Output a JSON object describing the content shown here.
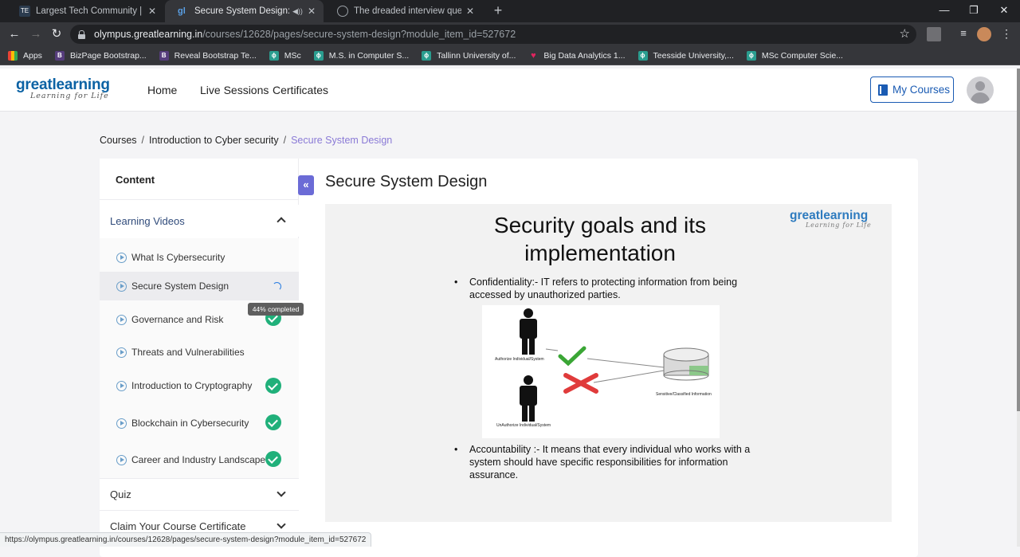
{
  "browser": {
    "tabs": [
      {
        "title": "Largest Tech Community | Hacker",
        "active": false
      },
      {
        "title": "Secure System Design: Introduc",
        "active": true
      },
      {
        "title": "The dreaded interview question:",
        "active": false
      }
    ],
    "url_host": "olympus.greatlearning.in",
    "url_path": "/courses/12628/pages/secure-system-design?module_item_id=527672",
    "bookmarks": [
      {
        "label": "Apps"
      },
      {
        "label": "BizPage Bootstrap..."
      },
      {
        "label": "Reveal Bootstrap Te..."
      },
      {
        "label": "MSc"
      },
      {
        "label": "M.S. in Computer S..."
      },
      {
        "label": "Tallinn University of..."
      },
      {
        "label": "Big Data Analytics 1..."
      },
      {
        "label": "Teesside University,..."
      },
      {
        "label": "MSc Computer Scie..."
      }
    ],
    "status_url": "https://olympus.greatlearning.in/courses/12628/pages/secure-system-design?module_item_id=527672"
  },
  "site": {
    "logo_main": "greatlearning",
    "logo_sub": "Learning for Life",
    "nav": [
      "Home",
      "Live Sessions",
      "Certificates"
    ],
    "my_courses": "My Courses"
  },
  "breadcrumb": {
    "courses": "Courses",
    "course": "Introduction to Cyber security",
    "current": "Secure System Design",
    "separator": "/"
  },
  "sidebar": {
    "header": "Content",
    "sections": {
      "learning_videos": "Learning Videos",
      "quiz": "Quiz",
      "certificate": "Claim Your Course Certificate"
    },
    "items": [
      {
        "label": "What Is Cybersecurity",
        "status": "none"
      },
      {
        "label": "Secure System Design",
        "status": "in-progress"
      },
      {
        "label": "Governance and Risk",
        "status": "completed"
      },
      {
        "label": "Threats and Vulnerabilities",
        "status": "none"
      },
      {
        "label": "Introduction to Cryptography",
        "status": "completed"
      },
      {
        "label": "Blockchain in Cybersecurity",
        "status": "completed"
      },
      {
        "label": "Career and Industry Landscape",
        "status": "completed"
      }
    ],
    "progress_tooltip": "44% completed",
    "progress_value": 0.44
  },
  "lesson": {
    "title": "Secure System Design"
  },
  "slide": {
    "title": "Security goals and its implementation",
    "logo_main": "greatlearning",
    "logo_sub": "Learning for Life",
    "bullet1": "Confidentiality:- IT refers to protecting information from being accessed by unauthorized parties.",
    "bullet2": "Accountability :- It means that every individual who works with a system should have specific responsibilities for information assurance.",
    "diagram": {
      "authorized": "Authorize Individual/System",
      "unauthorized": "UnAuthorize Individual/System",
      "target": "Sensitive/Classified Information"
    }
  },
  "colors": {
    "brand": "#0b62a4",
    "accent": "#6b6bd6",
    "success": "#20b07a",
    "breadcrumb_current": "#8a7ad6"
  }
}
